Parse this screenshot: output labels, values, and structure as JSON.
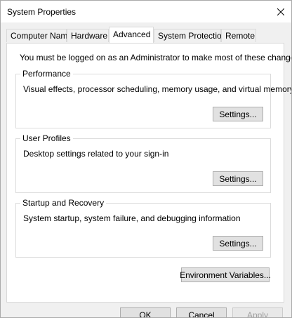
{
  "window": {
    "title": "System Properties"
  },
  "tabs": [
    {
      "label": "Computer Name",
      "active": false
    },
    {
      "label": "Hardware",
      "active": false
    },
    {
      "label": "Advanced",
      "active": true
    },
    {
      "label": "System Protection",
      "active": false
    },
    {
      "label": "Remote",
      "active": false
    }
  ],
  "advanced": {
    "notice": "You must be logged on as an Administrator to make most of these changes.",
    "performance": {
      "label": "Performance",
      "description": "Visual effects, processor scheduling, memory usage, and virtual memory",
      "button": "Settings..."
    },
    "user_profiles": {
      "label": "User Profiles",
      "description": "Desktop settings related to your sign-in",
      "button": "Settings..."
    },
    "startup_recovery": {
      "label": "Startup and Recovery",
      "description": "System startup, system failure, and debugging information",
      "button": "Settings..."
    },
    "env_button": "Environment Variables..."
  },
  "footer": {
    "ok": "OK",
    "cancel": "Cancel",
    "apply": "Apply"
  },
  "icons": {
    "close": "close-icon"
  }
}
